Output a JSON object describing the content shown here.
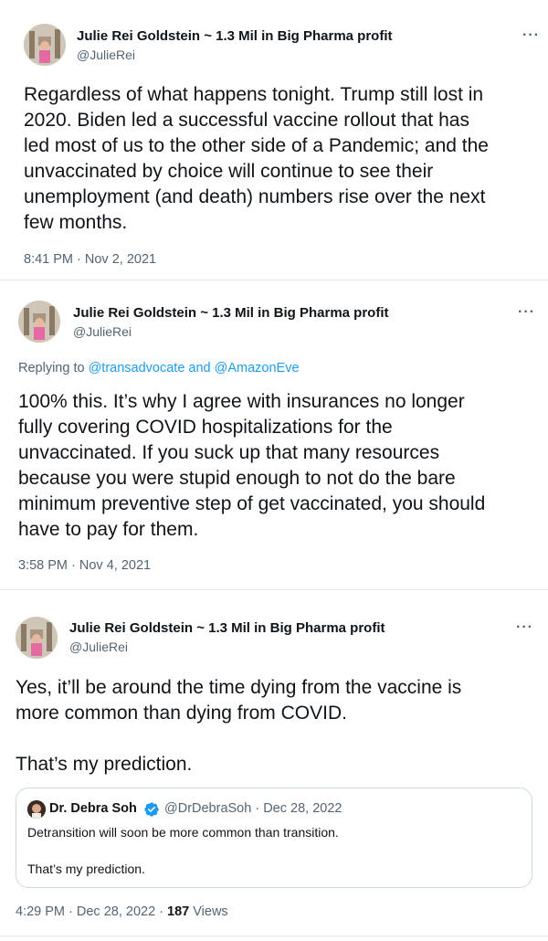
{
  "tweets": [
    {
      "author_name": "Julie Rei Goldstein ~ 1.3 Mil in Big Pharma profit",
      "author_handle": "@JulieRei",
      "more_icon": "···",
      "text": "Regardless of what happens tonight. Trump still lost in\n2020. Biden led a successful vaccine rollout that has\nled most of us to the other side of a Pandemic; and the\nunvaccinated by choice will continue to see their\nunemployment (and death) numbers rise over the next\nfew months.",
      "timestamp": "8:41 PM · Nov 2, 2021"
    },
    {
      "author_name": "Julie Rei Goldstein ~ 1.3 Mil in Big Pharma profit",
      "author_handle": "@JulieRei",
      "more_icon": "···",
      "replying_prefix": "Replying to ",
      "replying_to_1": "@transadvocate",
      "replying_and": " and ",
      "replying_to_2": "@AmazonEve",
      "text": "100% this. It’s why I agree with insurances no longer\nfully covering COVID hospitalizations for the\nunvaccinated. If you suck up that many resources\nbecause you were stupid enough to not do the bare\nminimum preventive step of get vaccinated, you should\nhave to pay for them.",
      "timestamp": "3:58 PM · Nov 4, 2021"
    },
    {
      "author_name": "Julie Rei Goldstein ~ 1.3 Mil in Big Pharma profit",
      "author_handle": "@JulieRei",
      "more_icon": "···",
      "text": "Yes, it’ll be around the time dying from the vaccine is\nmore common than dying from COVID.\n\nThat’s my prediction.",
      "timestamp": "4:29 PM · Dec 28, 2022 · ",
      "views_count": "187",
      "views_label": " Views",
      "quote": {
        "author_name": "Dr. Debra Soh",
        "author_handle": "@DrDebraSoh · Dec 28, 2022",
        "text": "Detransition will soon be more common than transition.\n\nThat’s my prediction."
      }
    }
  ],
  "colors": {
    "link": "#1d9bf0",
    "muted": "#536471",
    "text": "#0f1419",
    "verified": "#1d9bf0"
  }
}
